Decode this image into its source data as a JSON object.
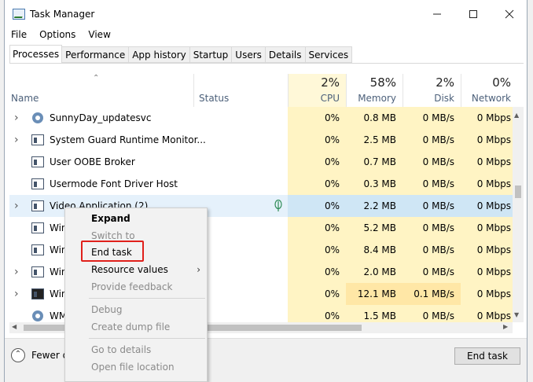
{
  "window": {
    "title": "Task Manager"
  },
  "menu": [
    "File",
    "Options",
    "View"
  ],
  "tabs": [
    "Processes",
    "Performance",
    "App history",
    "Startup",
    "Users",
    "Details",
    "Services"
  ],
  "columns": {
    "name": "Name",
    "status": "Status",
    "cpu": {
      "pct": "2%",
      "label": "CPU"
    },
    "memory": {
      "pct": "58%",
      "label": "Memory"
    },
    "disk": {
      "pct": "2%",
      "label": "Disk"
    },
    "network": {
      "pct": "0%",
      "label": "Network"
    }
  },
  "rows": [
    {
      "name": "SunnyDay_updatesvc",
      "cpu": "0%",
      "memory": "0.8 MB",
      "disk": "0 MB/s",
      "network": "0 Mbps"
    },
    {
      "name": "System Guard Runtime Monitor...",
      "cpu": "0%",
      "memory": "2.5 MB",
      "disk": "0 MB/s",
      "network": "0 Mbps"
    },
    {
      "name": "User OOBE Broker",
      "cpu": "0%",
      "memory": "0.7 MB",
      "disk": "0 MB/s",
      "network": "0 Mbps"
    },
    {
      "name": "Usermode Font Driver Host",
      "cpu": "0%",
      "memory": "0.3 MB",
      "disk": "0 MB/s",
      "network": "0 Mbps"
    },
    {
      "name": "Video Application (2)",
      "cpu": "0%",
      "memory": "2.2 MB",
      "disk": "0 MB/s",
      "network": "0 Mbps"
    },
    {
      "name": "Wind",
      "cpu": "0%",
      "memory": "5.2 MB",
      "disk": "0 MB/s",
      "network": "0 Mbps"
    },
    {
      "name": "Wind",
      "cpu": "0%",
      "memory": "8.4 MB",
      "disk": "0 MB/s",
      "network": "0 Mbps"
    },
    {
      "name": "Wind",
      "cpu": "0%",
      "memory": "2.0 MB",
      "disk": "0 MB/s",
      "network": "0 Mbps"
    },
    {
      "name": "Wind",
      "cpu": "0%",
      "memory": "12.1 MB",
      "disk": "0.1 MB/s",
      "network": "0 Mbps"
    },
    {
      "name": "WMI",
      "cpu": "0%",
      "memory": "1.5 MB",
      "disk": "0 MB/s",
      "network": "0 Mbps"
    }
  ],
  "context_menu": {
    "expand": "Expand",
    "switch_to": "Switch to",
    "end_task": "End task",
    "resource_values": "Resource values",
    "provide_feedback": "Provide feedback",
    "debug": "Debug",
    "create_dump_file": "Create dump file",
    "go_to_details": "Go to details",
    "open_file_location": "Open file location"
  },
  "footer": {
    "fewer_details": "Fewer d",
    "end_task": "End task"
  },
  "colors": {
    "highlight_box": "#e0201b",
    "cpu_col_bg": "#fff4c4",
    "selected_row": "#e5f1fb"
  }
}
